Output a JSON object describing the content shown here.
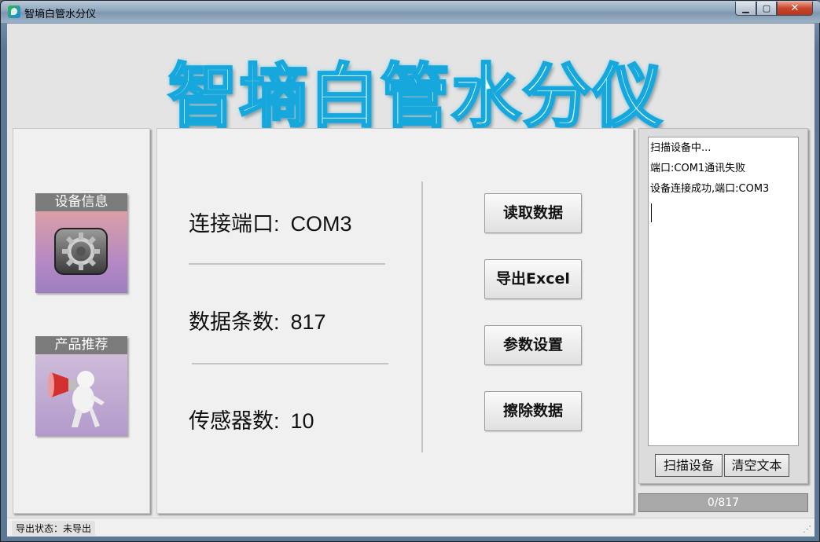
{
  "window": {
    "title": "智墒白管水分仪"
  },
  "banner": {
    "title": "智墒白管水分仪"
  },
  "left": {
    "device_info_label": "设备信息",
    "product_label": "产品推荐"
  },
  "info": {
    "port_label": "连接端口:",
    "port_value": "COM3",
    "count_label": "数据条数:",
    "count_value": "817",
    "sensor_label": "传感器数:",
    "sensor_value": "10"
  },
  "actions": {
    "read": "读取数据",
    "export": "导出Excel",
    "settings": "参数设置",
    "erase": "擦除数据"
  },
  "log": {
    "lines": [
      "扫描设备中...",
      "端口:COM1通讯失败",
      "设备连接成功,端口:COM3"
    ],
    "scan_button": "扫描设备",
    "clear_button": "清空文本"
  },
  "progress": {
    "text": "0/817",
    "value": 0,
    "max": 817
  },
  "status": {
    "text": "导出状态：未导出"
  },
  "colors": {
    "banner_stroke": "#16a8dc",
    "close_button": "#c8462c"
  },
  "icons": [
    "app-icon",
    "minimize-icon",
    "maximize-icon",
    "close-icon",
    "gear-icon",
    "megaphone-icon",
    "resize-grip-icon"
  ]
}
